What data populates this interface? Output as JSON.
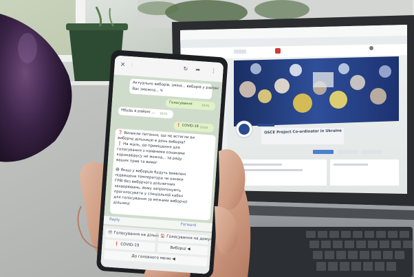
{
  "phone": {
    "top_bar": {
      "back_label": "←",
      "title_placeholder": "",
      "icons": [
        "close-icon",
        "refresh-icon",
        "share-icon",
        "more-icon"
      ]
    },
    "messages": [
      {
        "side": "in",
        "text": "Актуально виборів, зміна... виборів у районі"
      },
      {
        "side": "in",
        "text": "Вас зможна... Ч"
      },
      {
        "side": "out",
        "text": "Голосування",
        "time": "10:01"
      },
      {
        "side": "in",
        "text": "Нбудь в районі ...",
        "time": "10:01"
      },
      {
        "side": "out",
        "text": "❗ COVID-19",
        "time": "10:02"
      },
      {
        "side": "in",
        "lines": [
          "❓ Виникли питання, що не встигли ви",
          "виборче дільницю в день виборів?",
          "❗ На жаль, до приміщення для",
          "голосування з наявними ознаками",
          "коронавірусу не можна... за ряду",
          "ваших прав та вимог",
          "",
          "😷 Якщо у виборців будуть виявлені",
          "підвищена температура чи ознаки",
          "ГРВІ без виборчого дільничних",
          "захворювань, йому запропонують",
          "проголосувати у спеціальній кабіні",
          "для голосування за межами виборчої",
          "дільниці"
        ]
      }
    ],
    "reply_label": "Reply",
    "forward_label": "Forward",
    "keyboard": [
      {
        "label": "🗳 Голосування на дільниці"
      },
      {
        "label": "🏠 Голосування на дому»"
      },
      {
        "label": "❗ COVID-19"
      },
      {
        "label": "Виборці ◀"
      },
      {
        "label": "До головного меню ◀"
      }
    ]
  },
  "laptop": {
    "page_title": "OSCE Project Co-ordinator in Ukraine",
    "page_subtitle": "",
    "tab_items": []
  }
}
